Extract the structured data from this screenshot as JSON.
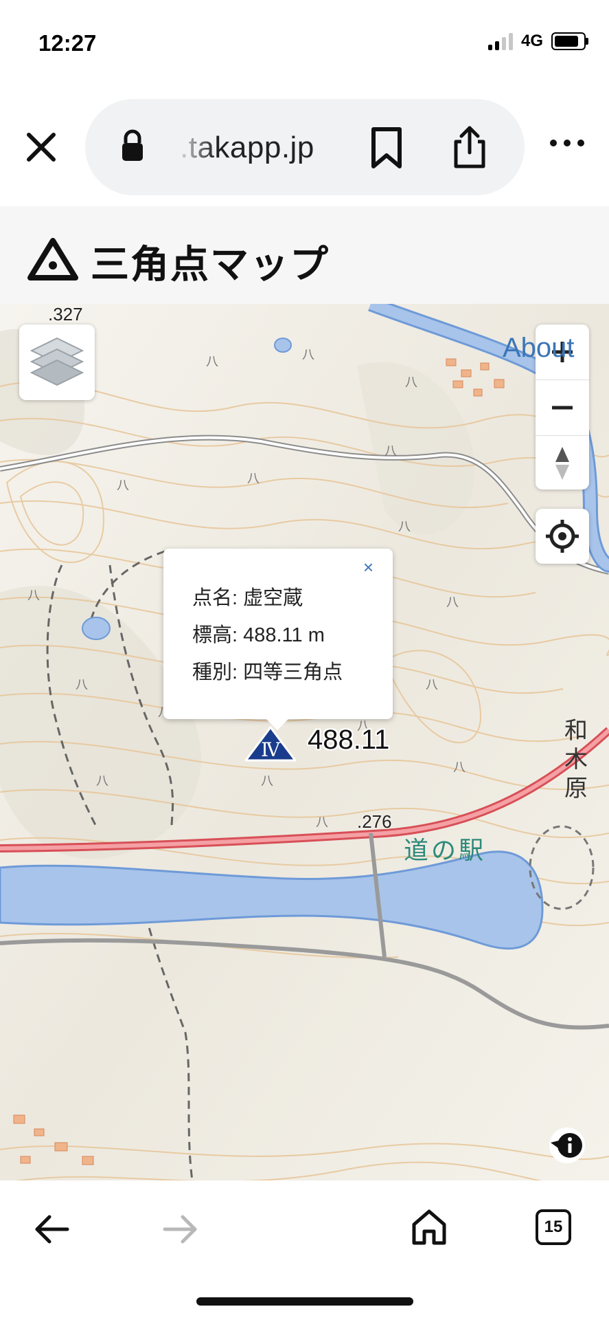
{
  "status_bar": {
    "time": "12:27",
    "network": "4G"
  },
  "browser": {
    "url": ".takapp.jp",
    "icons": [
      "close-icon",
      "lock-icon",
      "bookmark-icon",
      "share-icon",
      "more-icon"
    ]
  },
  "site": {
    "title": "三角点マップ",
    "logo_icon": "triangle-dot-logo"
  },
  "map": {
    "about_label": "About",
    "labels": {
      "elev_327": ".327",
      "elev_276": ".276",
      "michinoeki": "道の駅",
      "wagihara": "和木原"
    },
    "popup": {
      "name_line": "点名: 虚空蔵",
      "elevation_line": "標高: 488.11 m",
      "type_line": "種別: 四等三角点",
      "close_label": "×"
    },
    "marker": {
      "grade_numeral": "Ⅳ",
      "elevation": "488.11"
    },
    "colors": {
      "marker_blue": "#1a3c8c",
      "river_blue": "#a8c4ea",
      "road_red": "#e4676c",
      "contour": "#e8c59a"
    }
  },
  "bottom_nav": {
    "tab_count": "15"
  }
}
